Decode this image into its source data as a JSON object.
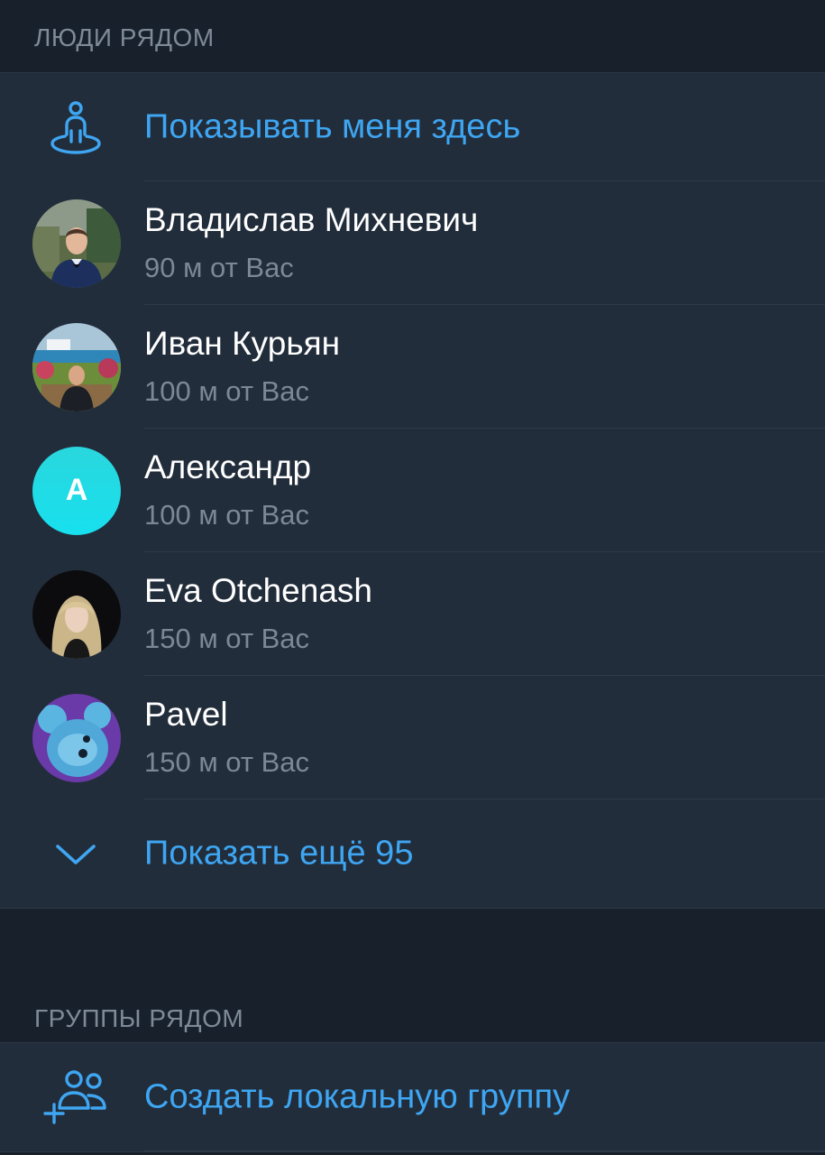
{
  "people_section": {
    "header": "ЛЮДИ РЯДОМ",
    "show_me": {
      "label": "Показывать меня здесь",
      "icon": "person-location-icon"
    },
    "people": [
      {
        "name": "Владислав Михневич",
        "distance": "90 м от Вас",
        "avatar": "photo"
      },
      {
        "name": "Иван Курьян",
        "distance": "100 м от Вас",
        "avatar": "photo"
      },
      {
        "name": "Александр",
        "distance": "100 м от Вас",
        "avatar_letter": "А",
        "avatar_color": "#1fdce8"
      },
      {
        "name": "Eva Otchenash",
        "distance": "150 м от Вас",
        "avatar": "photo"
      },
      {
        "name": "Pavel",
        "distance": "150 м от Вас",
        "avatar": "photo"
      }
    ],
    "show_more": {
      "label": "Показать ещё 95",
      "icon": "chevron-down-icon"
    }
  },
  "groups_section": {
    "header": "ГРУППЫ РЯДОМ",
    "create_group": {
      "label": "Создать локальную группу",
      "icon": "add-group-icon"
    }
  },
  "colors": {
    "background": "#18202b",
    "cell": "#222d3b",
    "accent": "#3ea6f2",
    "secondary_text": "#7c8896"
  }
}
